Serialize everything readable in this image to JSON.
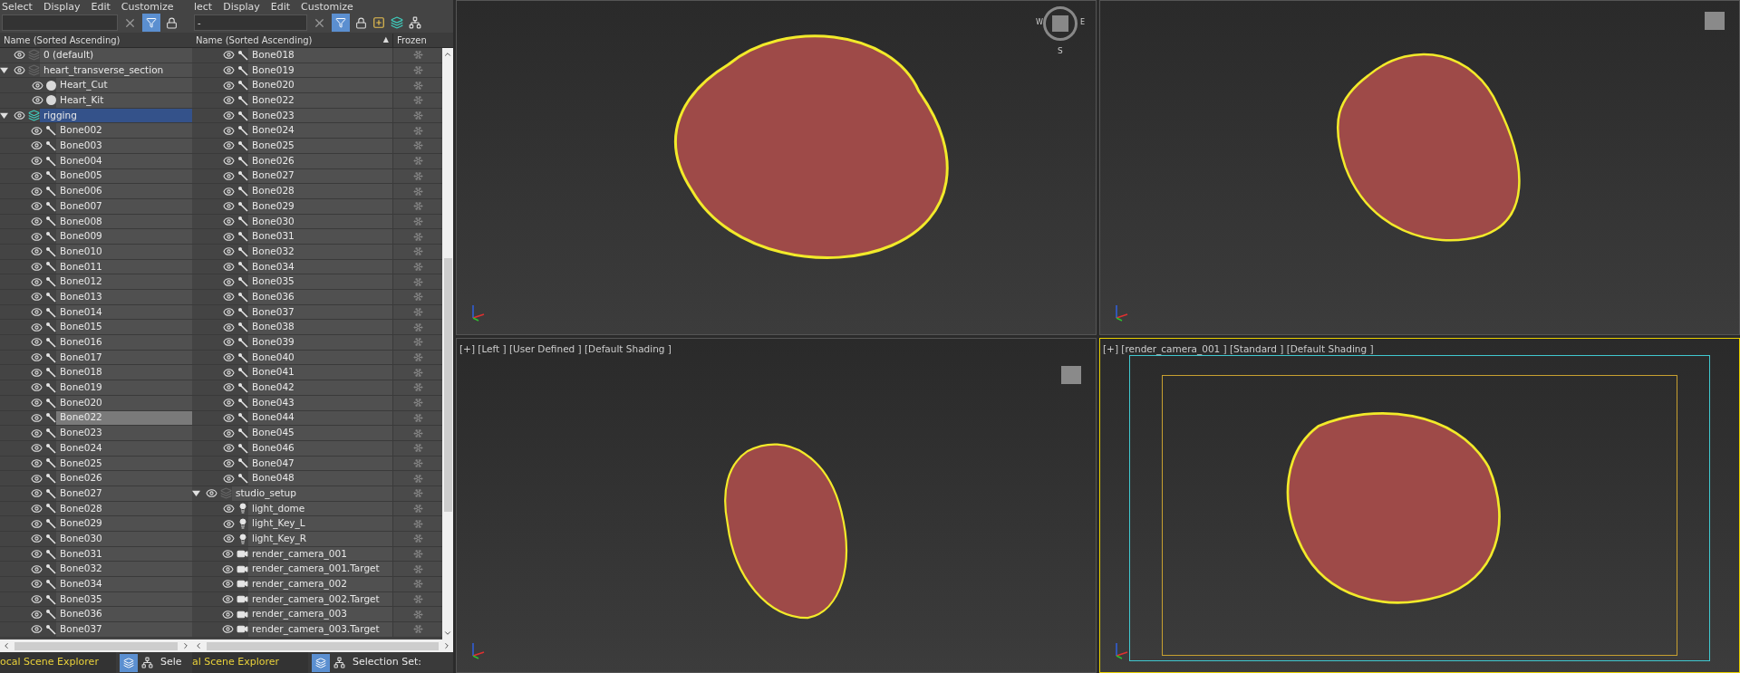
{
  "panels": [
    {
      "menu": [
        "Select",
        "Display",
        "Edit",
        "Customize"
      ],
      "filter_active": true,
      "columns": [
        "Name (Sorted Ascending)"
      ],
      "tree": [
        {
          "kind": "layer",
          "label": "0 (default)",
          "selected": false
        },
        {
          "kind": "layer",
          "label": "heart_transverse_section",
          "selected": false,
          "expanded": true,
          "children": [
            {
              "kind": "mesh",
              "label": "Heart_Cut",
              "selected": false
            },
            {
              "kind": "mesh",
              "label": "Heart_Kit",
              "selected": false
            }
          ]
        },
        {
          "kind": "layer",
          "label": "rigging",
          "selected": true,
          "expanded": true,
          "active_layer": true,
          "children": [
            {
              "kind": "bone",
              "label": "Bone002",
              "selected": false
            },
            {
              "kind": "bone",
              "label": "Bone003",
              "selected": false
            },
            {
              "kind": "bone",
              "label": "Bone004",
              "selected": false
            },
            {
              "kind": "bone",
              "label": "Bone005",
              "selected": false
            },
            {
              "kind": "bone",
              "label": "Bone006",
              "selected": false
            },
            {
              "kind": "bone",
              "label": "Bone007",
              "selected": false
            },
            {
              "kind": "bone",
              "label": "Bone008",
              "selected": false
            },
            {
              "kind": "bone",
              "label": "Bone009",
              "selected": false
            },
            {
              "kind": "bone",
              "label": "Bone010",
              "selected": false
            },
            {
              "kind": "bone",
              "label": "Bone011",
              "selected": false
            },
            {
              "kind": "bone",
              "label": "Bone012",
              "selected": false
            },
            {
              "kind": "bone",
              "label": "Bone013",
              "selected": false
            },
            {
              "kind": "bone",
              "label": "Bone014",
              "selected": false
            },
            {
              "kind": "bone",
              "label": "Bone015",
              "selected": false
            },
            {
              "kind": "bone",
              "label": "Bone016",
              "selected": false
            },
            {
              "kind": "bone",
              "label": "Bone017",
              "selected": false
            },
            {
              "kind": "bone",
              "label": "Bone018",
              "selected": false
            },
            {
              "kind": "bone",
              "label": "Bone019",
              "selected": false
            },
            {
              "kind": "bone",
              "label": "Bone020",
              "selected": false
            },
            {
              "kind": "bone",
              "label": "Bone022",
              "selected": true
            },
            {
              "kind": "bone",
              "label": "Bone023",
              "selected": false
            },
            {
              "kind": "bone",
              "label": "Bone024",
              "selected": false
            },
            {
              "kind": "bone",
              "label": "Bone025",
              "selected": false
            },
            {
              "kind": "bone",
              "label": "Bone026",
              "selected": false
            },
            {
              "kind": "bone",
              "label": "Bone027",
              "selected": false
            },
            {
              "kind": "bone",
              "label": "Bone028",
              "selected": false
            },
            {
              "kind": "bone",
              "label": "Bone029",
              "selected": false
            },
            {
              "kind": "bone",
              "label": "Bone030",
              "selected": false
            },
            {
              "kind": "bone",
              "label": "Bone031",
              "selected": false
            },
            {
              "kind": "bone",
              "label": "Bone032",
              "selected": false
            },
            {
              "kind": "bone",
              "label": "Bone034",
              "selected": false
            },
            {
              "kind": "bone",
              "label": "Bone035",
              "selected": false
            },
            {
              "kind": "bone",
              "label": "Bone036",
              "selected": false
            },
            {
              "kind": "bone",
              "label": "Bone037",
              "selected": false
            }
          ]
        }
      ],
      "footer": {
        "explorer": "ocal Scene Explorer",
        "selection_set": "Sele"
      }
    },
    {
      "menu": [
        "lect",
        "Display",
        "Edit",
        "Customize"
      ],
      "search": {
        "value": "-"
      },
      "filter_active": true,
      "columns": [
        "Name (Sorted Ascending)",
        "Frozen"
      ],
      "sort_arrow": "▲",
      "tree": [
        {
          "kind": "bone",
          "label": "Bone018",
          "selected": false
        },
        {
          "kind": "bone",
          "label": "Bone019",
          "selected": false
        },
        {
          "kind": "bone",
          "label": "Bone020",
          "selected": false
        },
        {
          "kind": "bone",
          "label": "Bone022",
          "selected": false
        },
        {
          "kind": "bone",
          "label": "Bone023",
          "selected": false
        },
        {
          "kind": "bone",
          "label": "Bone024",
          "selected": false
        },
        {
          "kind": "bone",
          "label": "Bone025",
          "selected": false
        },
        {
          "kind": "bone",
          "label": "Bone026",
          "selected": false
        },
        {
          "kind": "bone",
          "label": "Bone027",
          "selected": false
        },
        {
          "kind": "bone",
          "label": "Bone028",
          "selected": false
        },
        {
          "kind": "bone",
          "label": "Bone029",
          "selected": false
        },
        {
          "kind": "bone",
          "label": "Bone030",
          "selected": false
        },
        {
          "kind": "bone",
          "label": "Bone031",
          "selected": false
        },
        {
          "kind": "bone",
          "label": "Bone032",
          "selected": false
        },
        {
          "kind": "bone",
          "label": "Bone034",
          "selected": false
        },
        {
          "kind": "bone",
          "label": "Bone035",
          "selected": false
        },
        {
          "kind": "bone",
          "label": "Bone036",
          "selected": false
        },
        {
          "kind": "bone",
          "label": "Bone037",
          "selected": false
        },
        {
          "kind": "bone",
          "label": "Bone038",
          "selected": false
        },
        {
          "kind": "bone",
          "label": "Bone039",
          "selected": false
        },
        {
          "kind": "bone",
          "label": "Bone040",
          "selected": false
        },
        {
          "kind": "bone",
          "label": "Bone041",
          "selected": false
        },
        {
          "kind": "bone",
          "label": "Bone042",
          "selected": false
        },
        {
          "kind": "bone",
          "label": "Bone043",
          "selected": false
        },
        {
          "kind": "bone",
          "label": "Bone044",
          "selected": false
        },
        {
          "kind": "bone",
          "label": "Bone045",
          "selected": false
        },
        {
          "kind": "bone",
          "label": "Bone046",
          "selected": false
        },
        {
          "kind": "bone",
          "label": "Bone047",
          "selected": false
        },
        {
          "kind": "bone",
          "label": "Bone048",
          "selected": false
        },
        {
          "kind": "layer",
          "label": "studio_setup",
          "selected": false,
          "expanded": true,
          "children": [
            {
              "kind": "light",
              "label": "light_dome",
              "selected": false
            },
            {
              "kind": "light",
              "label": "light_Key_L",
              "selected": false
            },
            {
              "kind": "light",
              "label": "light_Key_R",
              "selected": false
            },
            {
              "kind": "camera",
              "label": "render_camera_001",
              "selected": false
            },
            {
              "kind": "camera",
              "label": "render_camera_001.Target",
              "selected": false
            },
            {
              "kind": "camera",
              "label": "render_camera_002",
              "selected": false
            },
            {
              "kind": "camera",
              "label": "render_camera_002.Target",
              "selected": false
            },
            {
              "kind": "camera",
              "label": "render_camera_003",
              "selected": false
            },
            {
              "kind": "camera",
              "label": "render_camera_003.Target",
              "selected": false
            }
          ]
        }
      ],
      "footer": {
        "explorer": "al Scene Explorer",
        "selection_set": "Selection Set:"
      }
    }
  ],
  "viewports": [
    {
      "kind": "perspective",
      "active": false,
      "compass": [
        "W",
        "E",
        "S"
      ]
    },
    {
      "kind": "perspective",
      "active": false
    },
    {
      "kind": "ortho",
      "active": false,
      "label": "[+] [Left ] [User Defined ] [Default Shading ]"
    },
    {
      "kind": "camera",
      "active": true,
      "label": "[+] [render_camera_001 ] [Standard ] [Default Shading ]"
    }
  ]
}
